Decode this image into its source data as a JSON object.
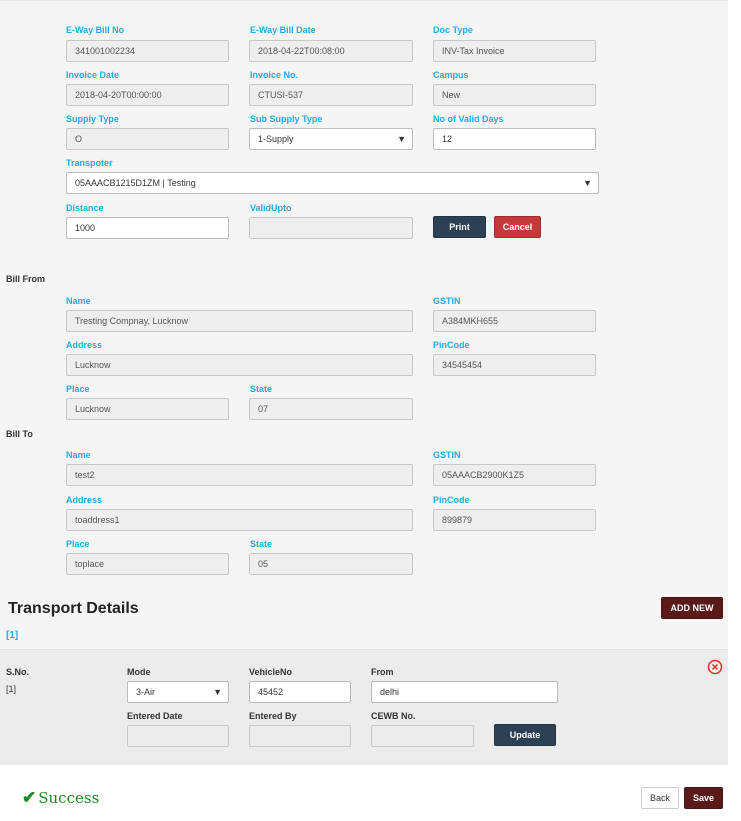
{
  "top": {
    "eway_bill_no_label": "E-Way Bill No",
    "eway_bill_no": "341001002234",
    "eway_bill_date_label": "E-Way Bill Date",
    "eway_bill_date": "2018-04-22T00:08:00",
    "doc_type_label": "Doc Type",
    "doc_type": "INV-Tax Invoice",
    "invoice_date_label": "Invoice Date",
    "invoice_date": "2018-04-20T00:00:00",
    "invoice_no_label": "Invoice No.",
    "invoice_no": "CTUSI-537",
    "campus_label": "Campus",
    "campus": "New",
    "supply_type_label": "Supply Type",
    "supply_type": "O",
    "sub_supply_type_label": "Sub Supply Type",
    "sub_supply_type": "1-Supply",
    "valid_days_label": "No of Valid Days",
    "valid_days": "12",
    "transporter_label": "Transpoter",
    "transporter": "05AAACB1215D1ZM | Testing",
    "distance_label": "Distance",
    "distance": "1000",
    "valid_upto_label": "ValidUpto",
    "valid_upto": "",
    "print_label": "Print",
    "cancel_label": "Cancel"
  },
  "bill_from": {
    "heading": "Bill From",
    "name_label": "Name",
    "name": "Tresting Compnay, Lucknow",
    "gstin_label": "GSTIN",
    "gstin": "A384MKH655",
    "address_label": "Address",
    "address": "Lucknow",
    "pincode_label": "PinCode",
    "pincode": "34545454",
    "place_label": "Place",
    "place": "Lucknow",
    "state_label": "State",
    "state": "07"
  },
  "bill_to": {
    "heading": "Bill To",
    "name_label": "Name",
    "name": "test2",
    "gstin_label": "GSTIN",
    "gstin": "05AAACB2900K1Z5",
    "address_label": "Address",
    "address": "toaddress1",
    "pincode_label": "PinCode",
    "pincode": "899879",
    "place_label": "Place",
    "place": "toplace",
    "state_label": "State",
    "state": "05"
  },
  "transport": {
    "title": "Transport Details",
    "add_new_label": "ADD NEW",
    "index_link": "[1]",
    "sno_label": "S.No.",
    "sno_value": "[1]",
    "mode_label": "Mode",
    "mode_value": "3-Air",
    "vehicle_label": "VehicleNo",
    "vehicle_value": "45452",
    "from_label": "From",
    "from_value": "delhi",
    "entered_date_label": "Entered Date",
    "entered_date_value": "",
    "entered_by_label": "Entered By",
    "entered_by_value": "",
    "cewb_label": "CEWB No.",
    "cewb_value": "",
    "update_label": "Update",
    "remove_icon": "close-circle-icon",
    "remove_color": "#d9312c"
  },
  "footer": {
    "success_text": "Success",
    "success_icon": "check-icon",
    "success_color": "#1e8a1e",
    "back_label": "Back",
    "save_label": "Save"
  }
}
